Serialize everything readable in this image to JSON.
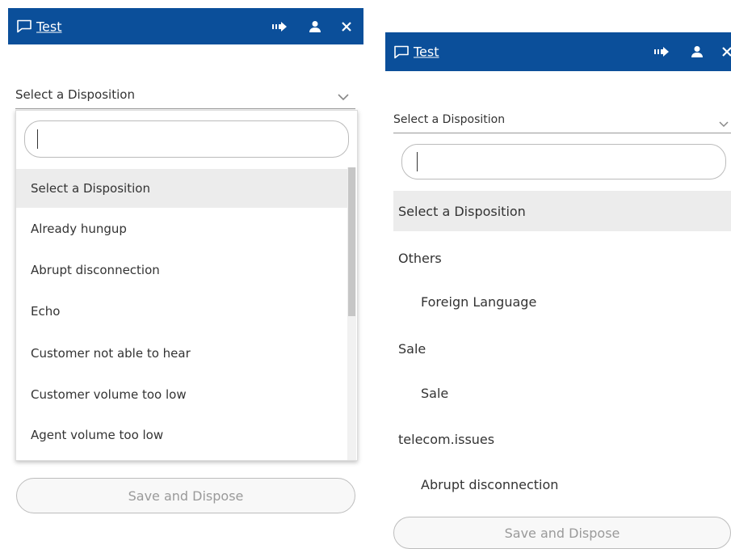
{
  "left": {
    "header": {
      "title": "Test",
      "icons": [
        "chat-icon",
        "transfer-icon",
        "user-icon",
        "close-icon"
      ]
    },
    "select": {
      "label": "Select a Disposition"
    },
    "dropdown": {
      "search_value": "",
      "options": [
        "Select a Disposition",
        "Already hungup",
        "Abrupt disconnection",
        "Echo",
        "Customer not able to hear",
        "Customer volume too low",
        "Agent volume too low"
      ]
    },
    "save_label": "Save and Dispose"
  },
  "right": {
    "header": {
      "title": "Test",
      "icons": [
        "chat-icon",
        "transfer-icon",
        "user-icon",
        "close-icon"
      ]
    },
    "select": {
      "label": "Select a Disposition"
    },
    "dropdown": {
      "search_value": "",
      "first_option": "Select a Disposition",
      "groups": [
        {
          "name": "Others",
          "items": [
            "Foreign Language"
          ]
        },
        {
          "name": "Sale",
          "items": [
            "Sale"
          ]
        },
        {
          "name": "telecom.issues",
          "items": [
            "Abrupt disconnection"
          ]
        }
      ]
    },
    "save_label": "Save and Dispose"
  },
  "colors": {
    "header_bg": "#0b4f9a",
    "selected_bg": "#ececec",
    "disabled_text": "#9a9a9a"
  }
}
